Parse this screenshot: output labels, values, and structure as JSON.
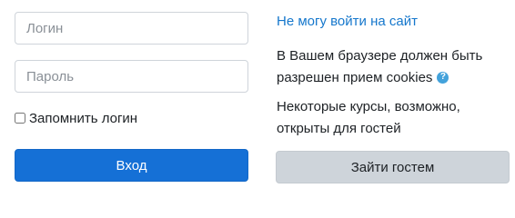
{
  "form": {
    "username_placeholder": "Логин",
    "username_value": "",
    "password_placeholder": "Пароль",
    "password_value": "",
    "remember_label": "Запомнить логин",
    "remember_checked": false,
    "login_button_label": "Вход"
  },
  "side": {
    "forgot_link": "Не могу войти на сайт",
    "cookies_note": "В Вашем браузере должен быть разрешен прием cookies",
    "help_icon_glyph": "?",
    "guest_note": "Некоторые курсы, возможно, открыты для гостей",
    "guest_button_label": "Зайти гостем"
  },
  "colors": {
    "primary": "#1570d6",
    "link": "#1577cc",
    "secondary_button": "#ced4da",
    "help_icon": "#43a2db"
  }
}
